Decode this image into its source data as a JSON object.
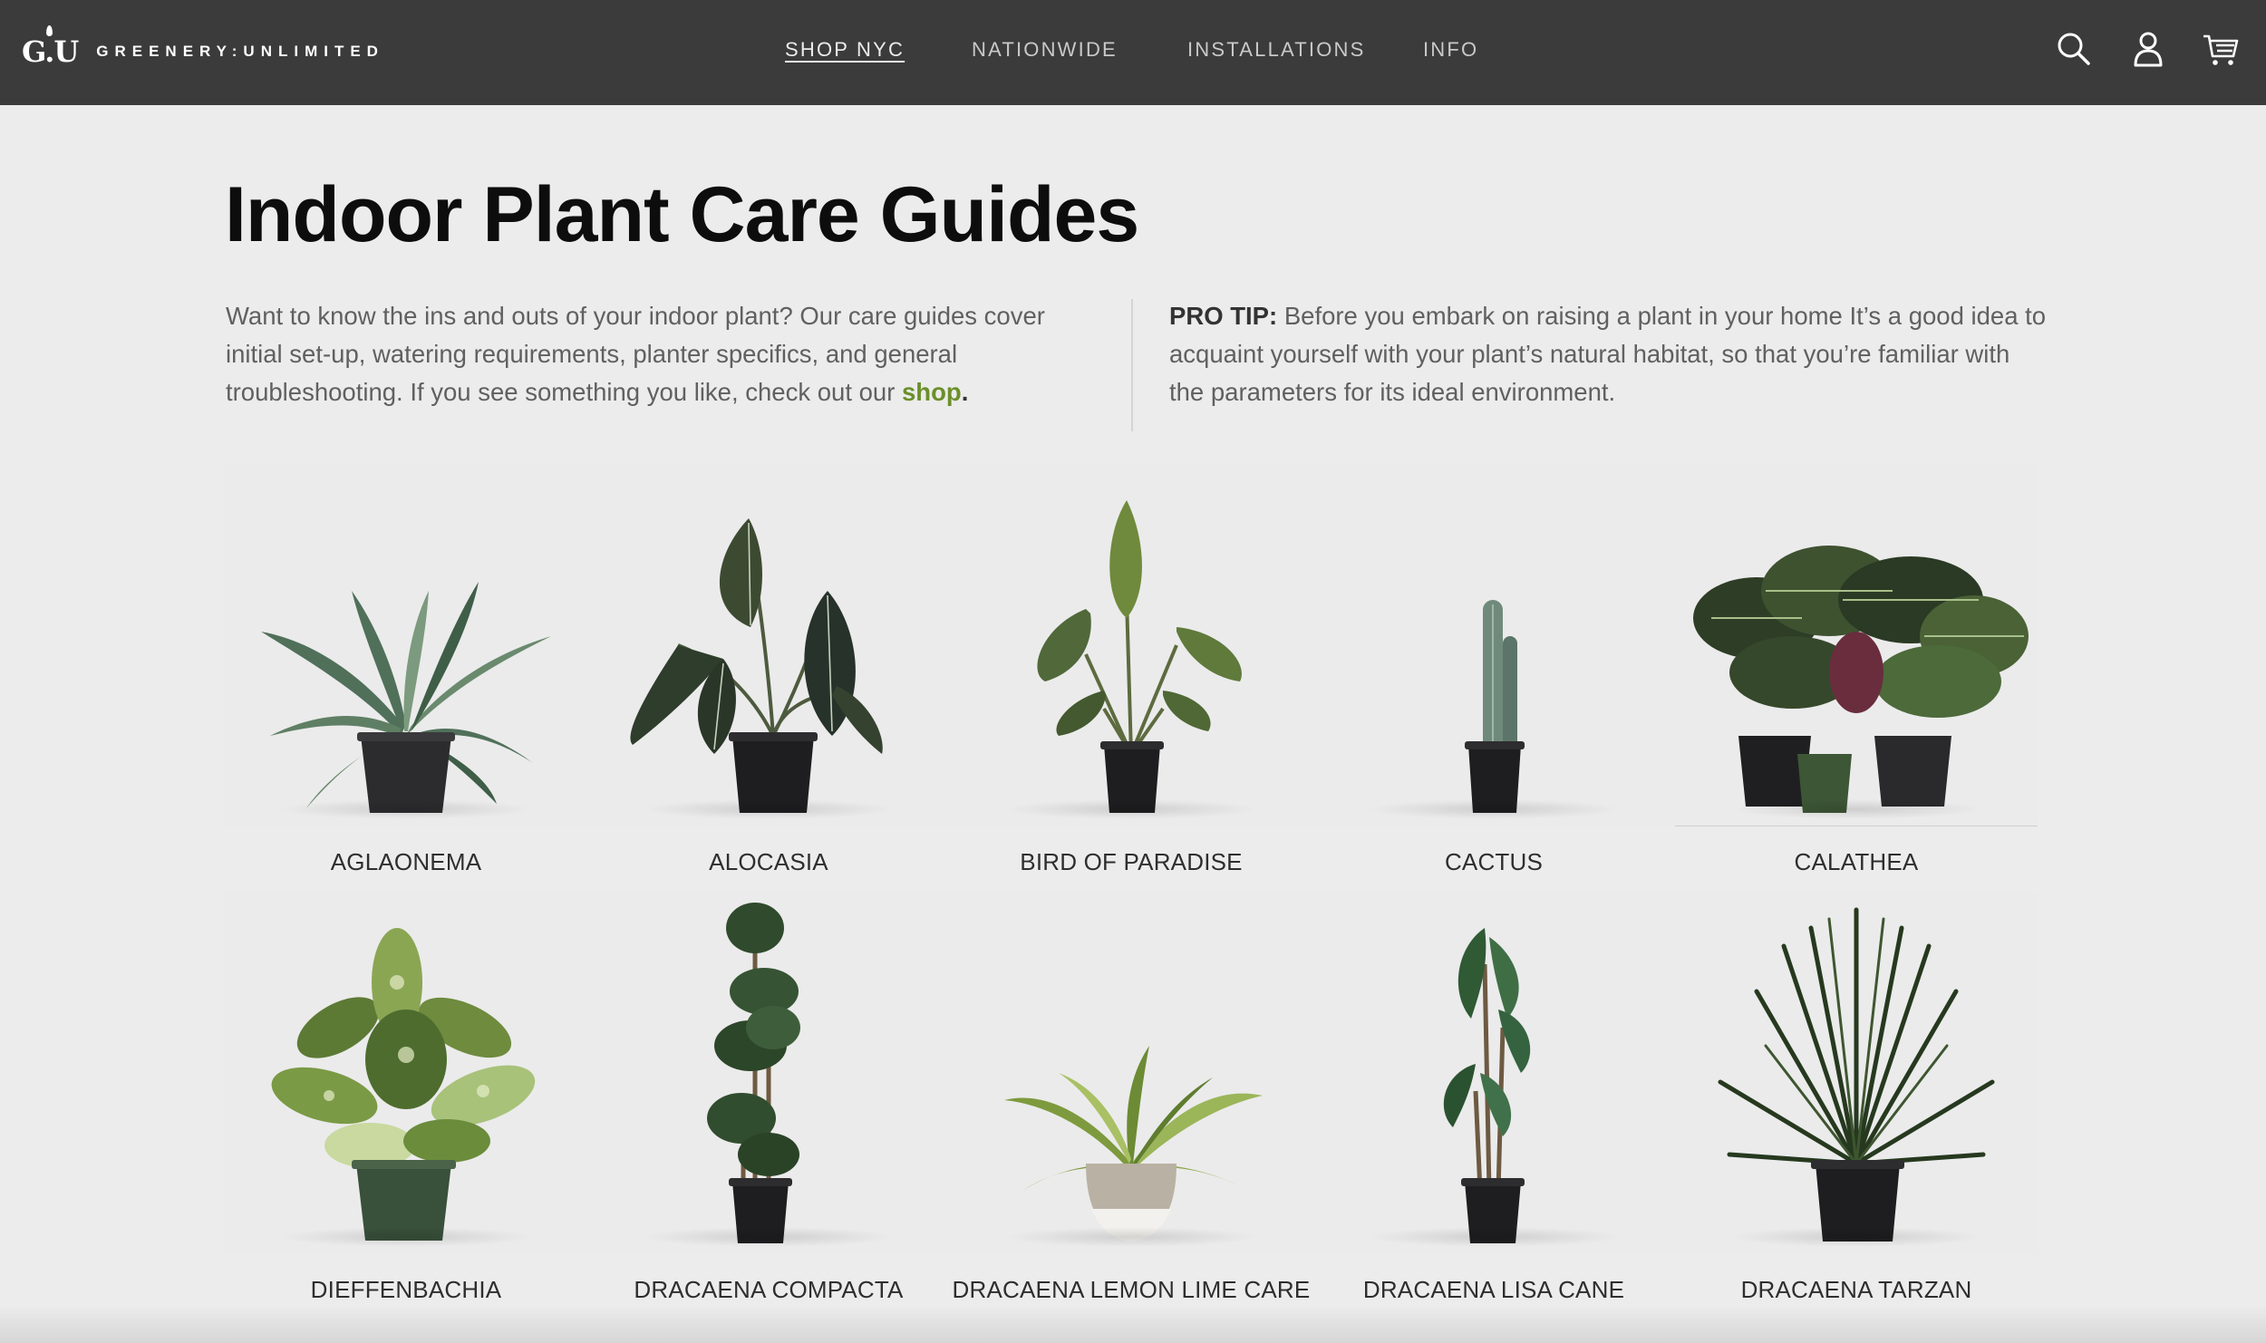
{
  "header": {
    "logo_mark": "G.U",
    "logo_text": "GREENERY:UNLIMITED",
    "nav": [
      {
        "label": "SHOP NYC",
        "active": true
      },
      {
        "label": "NATIONWIDE",
        "active": false
      },
      {
        "label": "INSTALLATIONS",
        "active": false
      },
      {
        "label": "INFO",
        "active": false
      }
    ],
    "icons": [
      "search-icon",
      "account-icon",
      "cart-icon"
    ]
  },
  "page": {
    "title": "Indoor Plant Care Guides",
    "intro_text": "Want to know the ins and outs of your indoor plant? Our care guides cover initial set-up, watering requirements, planter specifics, and general troubleshooting. If you see something you like, check out our",
    "intro_link": "shop",
    "intro_end": ".",
    "protip_label": "PRO TIP:",
    "protip_text": "Before you embark on raising a plant in your home It’s a good idea to acquaint yourself with your plant’s natural habitat, so that you’re familiar with the parameters for its ideal environment."
  },
  "colors": {
    "header_bg": "#3b3b3b",
    "page_bg": "#ececec",
    "link_green": "#6b8f2a"
  },
  "guides": [
    {
      "label": "AGLAONEMA"
    },
    {
      "label": "ALOCASIA"
    },
    {
      "label": "BIRD OF PARADISE"
    },
    {
      "label": "CACTUS"
    },
    {
      "label": "CALATHEA"
    },
    {
      "label": "DIEFFENBACHIA"
    },
    {
      "label": "DRACAENA COMPACTA"
    },
    {
      "label": "DRACAENA LEMON LIME CARE"
    },
    {
      "label": "DRACAENA LISA CANE"
    },
    {
      "label": "DRACAENA TARZAN"
    }
  ]
}
